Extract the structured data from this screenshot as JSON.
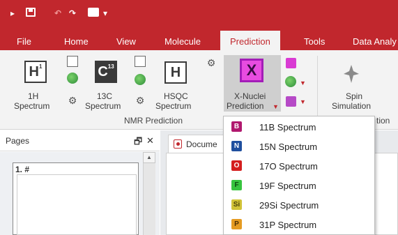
{
  "quick_access": {
    "pin": "▸",
    "undo": "↶",
    "redo": "↷",
    "dropdown": "▾",
    "icons": [
      "pin-icon",
      "save-icon",
      "undo-icon",
      "redo-icon",
      "print-icon",
      "customize-icon"
    ]
  },
  "tabs": [
    "File",
    "Home",
    "View",
    "Molecule",
    "Prediction",
    "Tools",
    "Data Analy"
  ],
  "active_tab": "Prediction",
  "ribbon": {
    "buttons": [
      {
        "icon_text": "H",
        "label1": "1H",
        "label2": "Spectrum"
      },
      {
        "icon_text": "C",
        "label1": "13C",
        "label2": "Spectrum"
      },
      {
        "icon_text": "H",
        "label1": "HSQC",
        "label2": "Spectrum"
      },
      {
        "icon_text": "X",
        "label1": "X-Nuclei",
        "label2": "Prediction"
      },
      {
        "label1": "Spin",
        "label2": "Simulation"
      }
    ],
    "group_label": "NMR Prediction",
    "group_label_partial": "tion"
  },
  "pages_pane": {
    "title": "Pages",
    "pin": "🗗",
    "close": "✕",
    "page_number": "1.",
    "page_hash": "#",
    "scroll_up": "▲"
  },
  "document_tab": {
    "label": "Docume"
  },
  "dropdown_menu": {
    "items": [
      {
        "badge": "B",
        "label": "11B Spectrum",
        "color": "#b0186e",
        "text_color": "#ffffff"
      },
      {
        "badge": "N",
        "label": "15N Spectrum",
        "color": "#1f4f9e",
        "text_color": "#ffffff"
      },
      {
        "badge": "O",
        "label": "17O Spectrum",
        "color": "#d41f1f",
        "text_color": "#ffffff"
      },
      {
        "badge": "F",
        "label": "19F Spectrum",
        "color": "#37c43f",
        "text_color": "#0c4a10"
      },
      {
        "badge": "Si",
        "label": "29Si Spectrum",
        "color": "#d1c236",
        "text_color": "#4a4208"
      },
      {
        "badge": "P",
        "label": "31P Spectrum",
        "color": "#e59b22",
        "text_color": "#4a2e05"
      }
    ]
  },
  "colors": {
    "title_bar": "#c1272d",
    "ribbon_bg": "#f3f3f3",
    "xnuclei_magenta": "#e84ce0"
  }
}
